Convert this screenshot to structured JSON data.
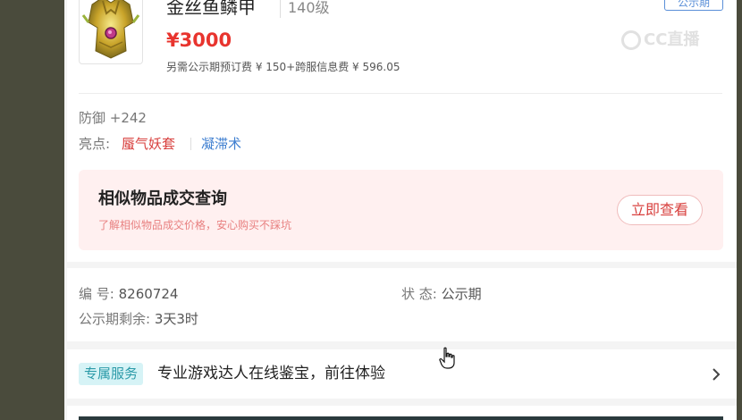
{
  "item": {
    "name": "金丝鱼鳞甲",
    "level": "140级",
    "price": "¥3000",
    "fee_note": "另需公示期预订费 ¥ 150+跨服信息费 ¥ 596.05",
    "public_tag": "公示期",
    "watermark": "CC直播"
  },
  "attributes": {
    "defense": "防御 +242",
    "highlight_label": "亮点:",
    "highlights": [
      "蜃气妖套",
      "凝滞术"
    ]
  },
  "similar_banner": {
    "title": "相似物品成交查询",
    "subtitle": "了解相似物品成交价格，安心购买不踩坑",
    "button": "立即查看"
  },
  "order_info": {
    "id_label": "编  号:",
    "id_value": "8260724",
    "status_label": "状  态:",
    "status_value": "公示期",
    "remaining_label": "公示期剩余:",
    "remaining_value": "3天3时"
  },
  "service": {
    "badge": "专属服务",
    "text": "专业游戏达人在线鉴宝，前往体验"
  },
  "colors": {
    "price_red": "#e8342e",
    "accent_blue": "#3f7fd0",
    "highlight_red": "#d8403e",
    "banner_bg": "#fff0f0",
    "service_badge_bg": "#d6f3f6"
  },
  "icons": [
    "armor-item-thumbnail",
    "chevron-right-icon",
    "hand-pointer-cursor"
  ]
}
